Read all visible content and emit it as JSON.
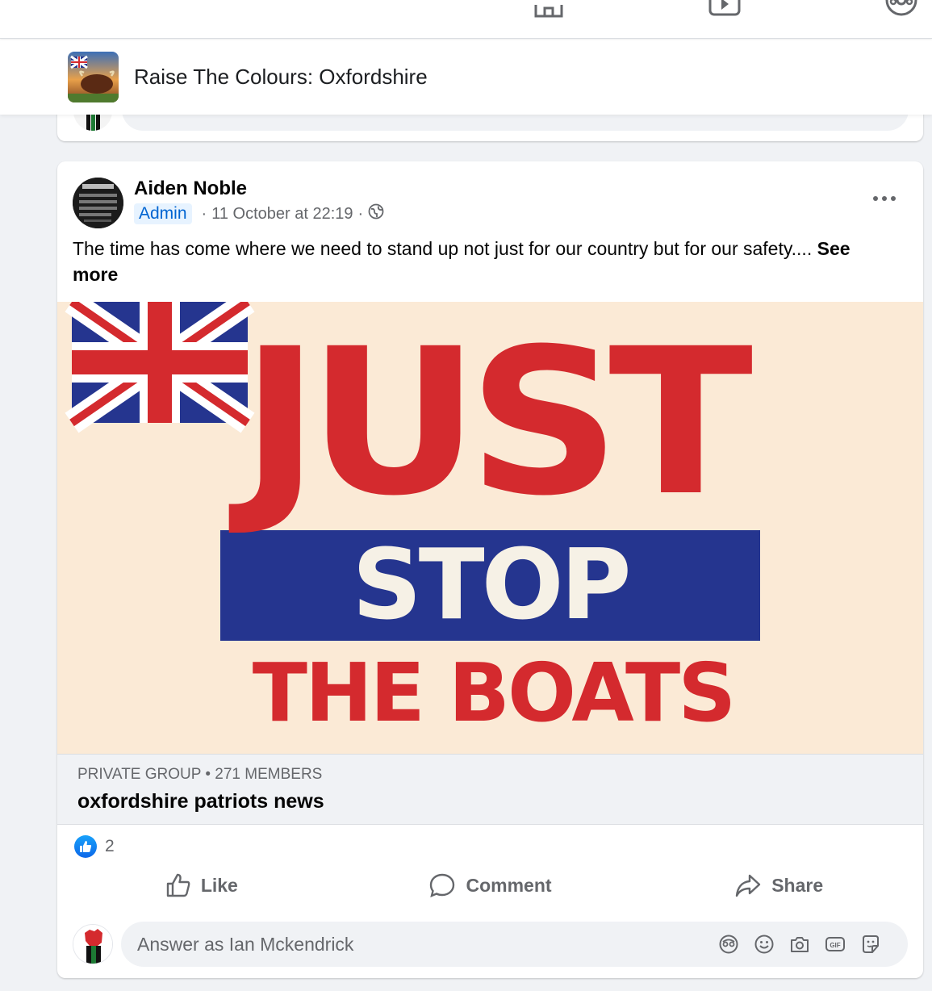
{
  "group": {
    "name": "Raise The Colours: Oxfordshire"
  },
  "post": {
    "author": "Aiden Noble",
    "role_badge": "Admin",
    "separator": "·",
    "timestamp": "11 October at 22:19",
    "audience_icon": "globe-icon",
    "text": "The time has come where we need to stand up not just for our country but for our safety.... ",
    "see_more": "See more",
    "image": {
      "word1": "JUST",
      "word2": "STOP",
      "word3": "THE BOATS"
    },
    "link_preview": {
      "meta": "PRIVATE GROUP • 271 MEMBERS",
      "title": "oxfordshire patriots news"
    },
    "reaction_count": "2",
    "actions": {
      "like": "Like",
      "comment": "Comment",
      "share": "Share"
    },
    "comment_placeholder": "Answer as Ian Mckendrick"
  },
  "colors": {
    "accent_blue": "#0866ff",
    "flag_red": "#d42a2e",
    "flag_blue": "#25358f",
    "image_bg": "#fbead6"
  }
}
